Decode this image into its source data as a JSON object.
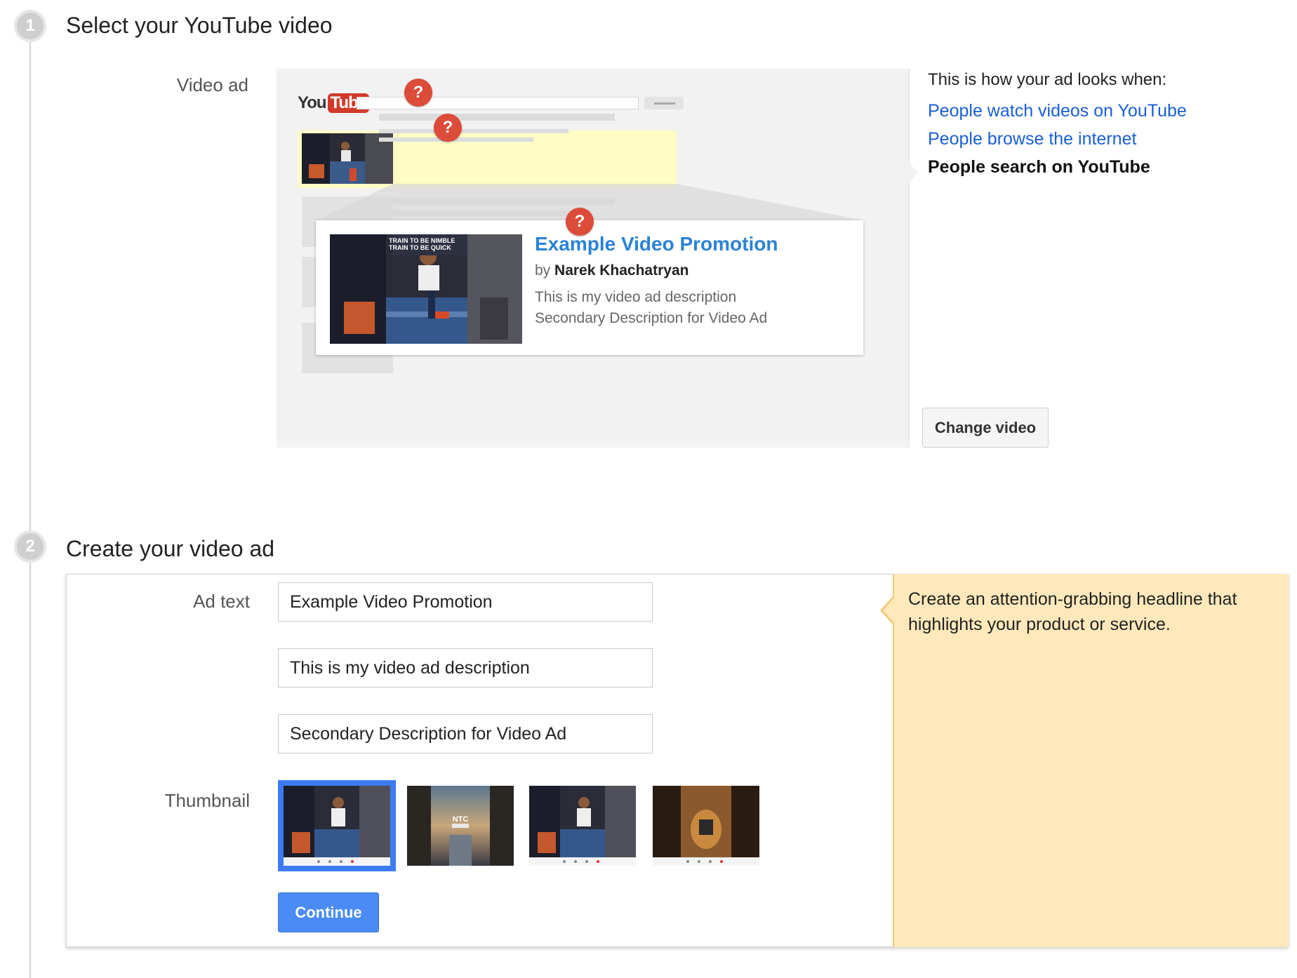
{
  "step1": {
    "number": "1",
    "title": "Select your YouTube video",
    "label": "Video ad"
  },
  "preview": {
    "logo_you": "You",
    "logo_tube": "Tube",
    "help_glyph": "?",
    "thumb_overlay_text": "TRAIN TO BE NIMBLE TRAIN TO BE QUICK",
    "card": {
      "title": "Example Video Promotion",
      "by_prefix": "by",
      "channel": "Narek Khachatryan",
      "desc1": "This is my video ad description",
      "desc2": "Secondary Description for Video Ad"
    }
  },
  "views": {
    "heading": "This is how your ad looks when:",
    "watch": "People watch videos on YouTube",
    "browse": "People browse the internet",
    "search": "People search on YouTube",
    "selected": "search"
  },
  "change_video_label": "Change video",
  "step2": {
    "number": "2",
    "title": "Create your video ad",
    "ad_text_label": "Ad text",
    "thumbnail_label": "Thumbnail",
    "headline_value": "Example Video Promotion",
    "desc1_value": "This is my video ad description",
    "desc2_value": "Secondary Description for Video Ad",
    "thumbnails": [
      "thumbnail-1",
      "thumbnail-2",
      "thumbnail-3",
      "thumbnail-4"
    ],
    "selected_thumbnail_index": 0,
    "thumb2_overlay": "NTC",
    "continue_label": "Continue"
  },
  "tip": {
    "text": "Create an attention-grabbing headline that highlights your product or service."
  },
  "colors": {
    "link_blue": "#1a5fd6",
    "card_title_blue": "#2a82d6",
    "help_red": "#dd4b39",
    "primary_button": "#4a8bf5",
    "tip_background": "#ffe9bb"
  }
}
